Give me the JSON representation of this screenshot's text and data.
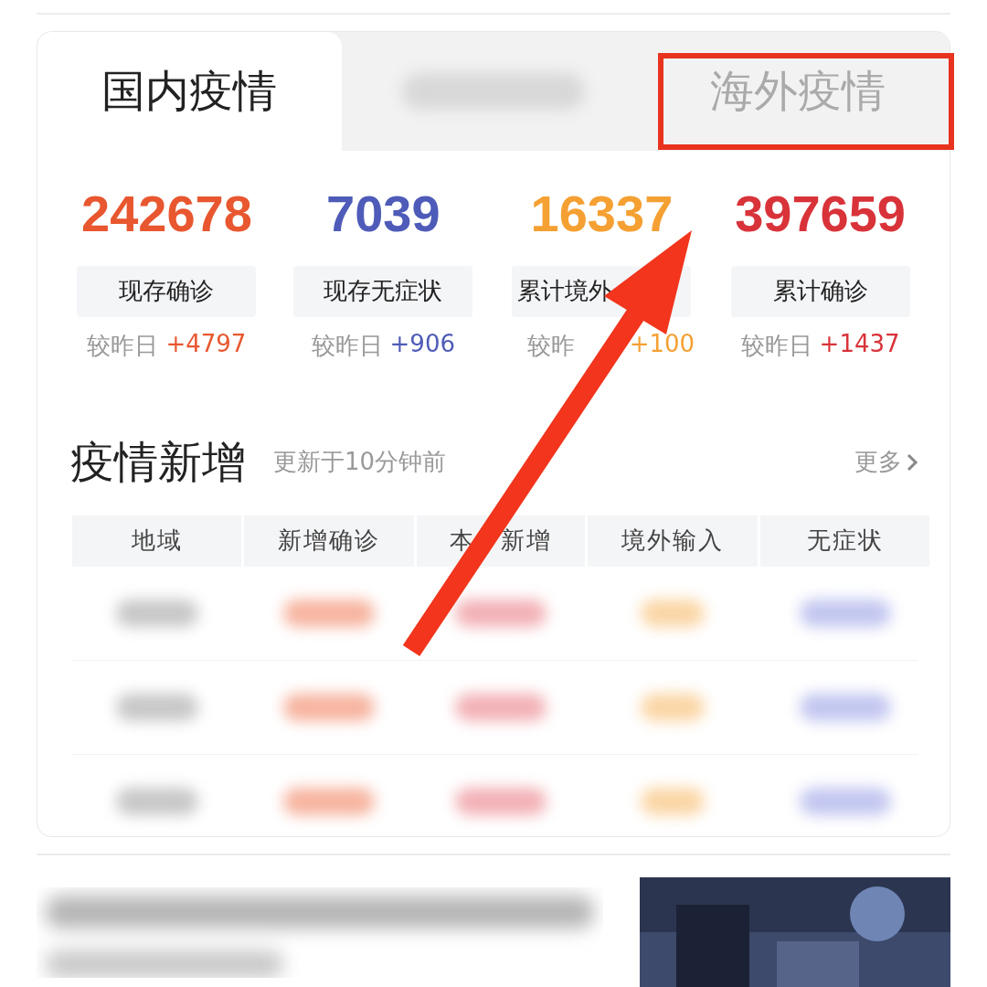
{
  "tabs": [
    {
      "label": "国内疫情",
      "selected": true
    },
    {
      "kind": "blurred",
      "selected": false
    },
    {
      "label": "海外疫情",
      "selected": false
    }
  ],
  "stats": [
    {
      "kind": "plain",
      "value": "242678",
      "label": "现存确诊",
      "delta_label": "较昨日",
      "delta": "+4797",
      "color": "#e8572f"
    },
    {
      "kind": "plain",
      "value": "7039",
      "label": "现存无症状",
      "delta_label": "较昨日",
      "delta": "+906",
      "color": "#4e5bb8"
    },
    {
      "kind": "covered",
      "value": "16337",
      "label": "累计境外",
      "delta_label": "较昨",
      "delta": "+100",
      "color": "#f5a032"
    },
    {
      "kind": "plain",
      "value": "397659",
      "label": "累计确诊",
      "delta_label": "较昨日",
      "delta": "+1437",
      "color": "#d9333a"
    }
  ],
  "section": {
    "title": "疫情新增",
    "updated": "更新于10分钟前",
    "more": "更多"
  },
  "table": {
    "columns": [
      "地域",
      "新增确诊",
      "本　新增",
      "境外输入",
      "无症状"
    ],
    "rows": [
      {
        "kind": "blurred"
      },
      {
        "kind": "blurred"
      },
      {
        "kind": "blurred"
      }
    ]
  }
}
